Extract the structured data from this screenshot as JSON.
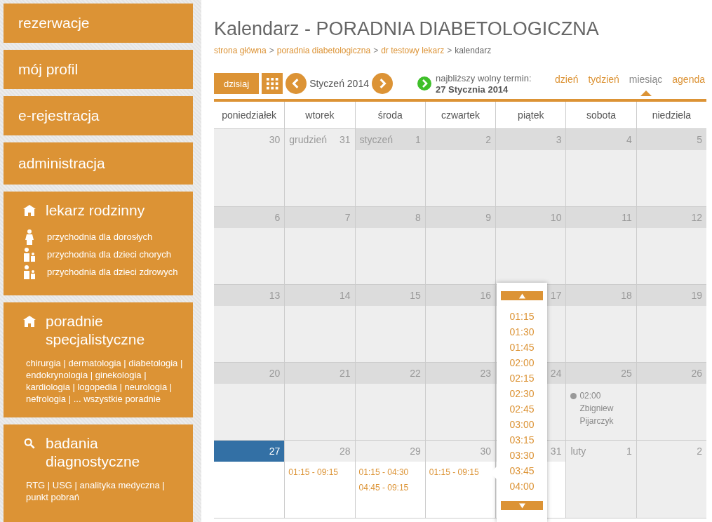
{
  "sidebar": {
    "items": [
      {
        "label": "rezerwacje"
      },
      {
        "label": "mój profil"
      },
      {
        "label": "e-rejestracja"
      },
      {
        "label": "administracja"
      }
    ],
    "sections": [
      {
        "title": "lekarz rodzinny",
        "links": [
          {
            "label": "przychodnia dla dorosłych",
            "kind": "adult"
          },
          {
            "label": "przychodnia dla dzieci chorych",
            "kind": "children"
          },
          {
            "label": "przychodnia dla dzieci zdrowych",
            "kind": "children"
          }
        ]
      },
      {
        "title": "poradnie specjalistyczne",
        "text": "chirurgia | dermatologia | diabetologia | endokrynologia | ginekologia | kardiologia | logopedia | neurologia | nefrologia | ... wszystkie poradnie"
      },
      {
        "title": "badania diagnostyczne",
        "text": "RTG | USG | analityka medyczna | punkt pobrań"
      }
    ]
  },
  "page": {
    "title": "Kalendarz - PORADNIA DIABETOLOGICZNA",
    "breadcrumb_separator": ">",
    "breadcrumb": [
      {
        "label": "strona główna",
        "link": true
      },
      {
        "label": "poradnia diabetologiczna",
        "link": true
      },
      {
        "label": "dr testowy lekarz",
        "link": true
      },
      {
        "label": "kalendarz",
        "link": false
      }
    ]
  },
  "toolbar": {
    "today": "dzisiaj",
    "month": "Styczeń 2014",
    "next_free_label": "najbliższy wolny termin:",
    "next_free_date": "27 Stycznia 2014",
    "views": [
      {
        "label": "dzień",
        "selected": false
      },
      {
        "label": "tydzień",
        "selected": false
      },
      {
        "label": "miesiąc",
        "selected": true
      },
      {
        "label": "agenda",
        "selected": false
      }
    ]
  },
  "calendar": {
    "weekdays": [
      "poniedziałek",
      "wtorek",
      "środa",
      "czwartek",
      "piątek",
      "sobota",
      "niedziela"
    ],
    "weeks": [
      [
        {
          "day": "30",
          "kind": "other"
        },
        {
          "day": "31",
          "month": "grudzień",
          "kind": "other"
        },
        {
          "day": "1",
          "month": "styczeń",
          "kind": "past"
        },
        {
          "day": "2",
          "kind": "past"
        },
        {
          "day": "3",
          "kind": "past"
        },
        {
          "day": "4",
          "kind": "past"
        },
        {
          "day": "5",
          "kind": "past"
        }
      ],
      [
        {
          "day": "6",
          "kind": "past"
        },
        {
          "day": "7",
          "kind": "past"
        },
        {
          "day": "8",
          "kind": "past"
        },
        {
          "day": "9",
          "kind": "past"
        },
        {
          "day": "10",
          "kind": "past"
        },
        {
          "day": "11",
          "kind": "past"
        },
        {
          "day": "12",
          "kind": "past"
        }
      ],
      [
        {
          "day": "13",
          "kind": "past"
        },
        {
          "day": "14",
          "kind": "past"
        },
        {
          "day": "15",
          "kind": "past"
        },
        {
          "day": "16",
          "kind": "past"
        },
        {
          "day": "17",
          "kind": "past"
        },
        {
          "day": "18",
          "kind": "past"
        },
        {
          "day": "19",
          "kind": "past"
        }
      ],
      [
        {
          "day": "20",
          "kind": "past"
        },
        {
          "day": "21",
          "kind": "past"
        },
        {
          "day": "22",
          "kind": "past"
        },
        {
          "day": "23",
          "kind": "past"
        },
        {
          "day": "24",
          "kind": "past"
        },
        {
          "day": "25",
          "kind": "past",
          "event": {
            "time": "02:00",
            "person": "Zbigniew Pijarczyk"
          }
        },
        {
          "day": "26",
          "kind": "past"
        }
      ],
      [
        {
          "day": "27",
          "kind": "today"
        },
        {
          "day": "28",
          "kind": "open",
          "slots": [
            "01:15 - 09:15"
          ]
        },
        {
          "day": "29",
          "kind": "open",
          "slots": [
            "01:15 - 04:30",
            "04:45 - 09:15"
          ]
        },
        {
          "day": "30",
          "kind": "open",
          "slots": [
            "01:15 - 09:15"
          ]
        },
        {
          "day": "31",
          "kind": "open"
        },
        {
          "day": "1",
          "month": "luty",
          "kind": "other"
        },
        {
          "day": "2",
          "kind": "other"
        }
      ]
    ]
  },
  "time_picker": {
    "times": [
      "01:15",
      "01:30",
      "01:45",
      "02:00",
      "02:15",
      "02:30",
      "02:45",
      "03:00",
      "03:15",
      "03:30",
      "03:45",
      "04:00"
    ]
  }
}
